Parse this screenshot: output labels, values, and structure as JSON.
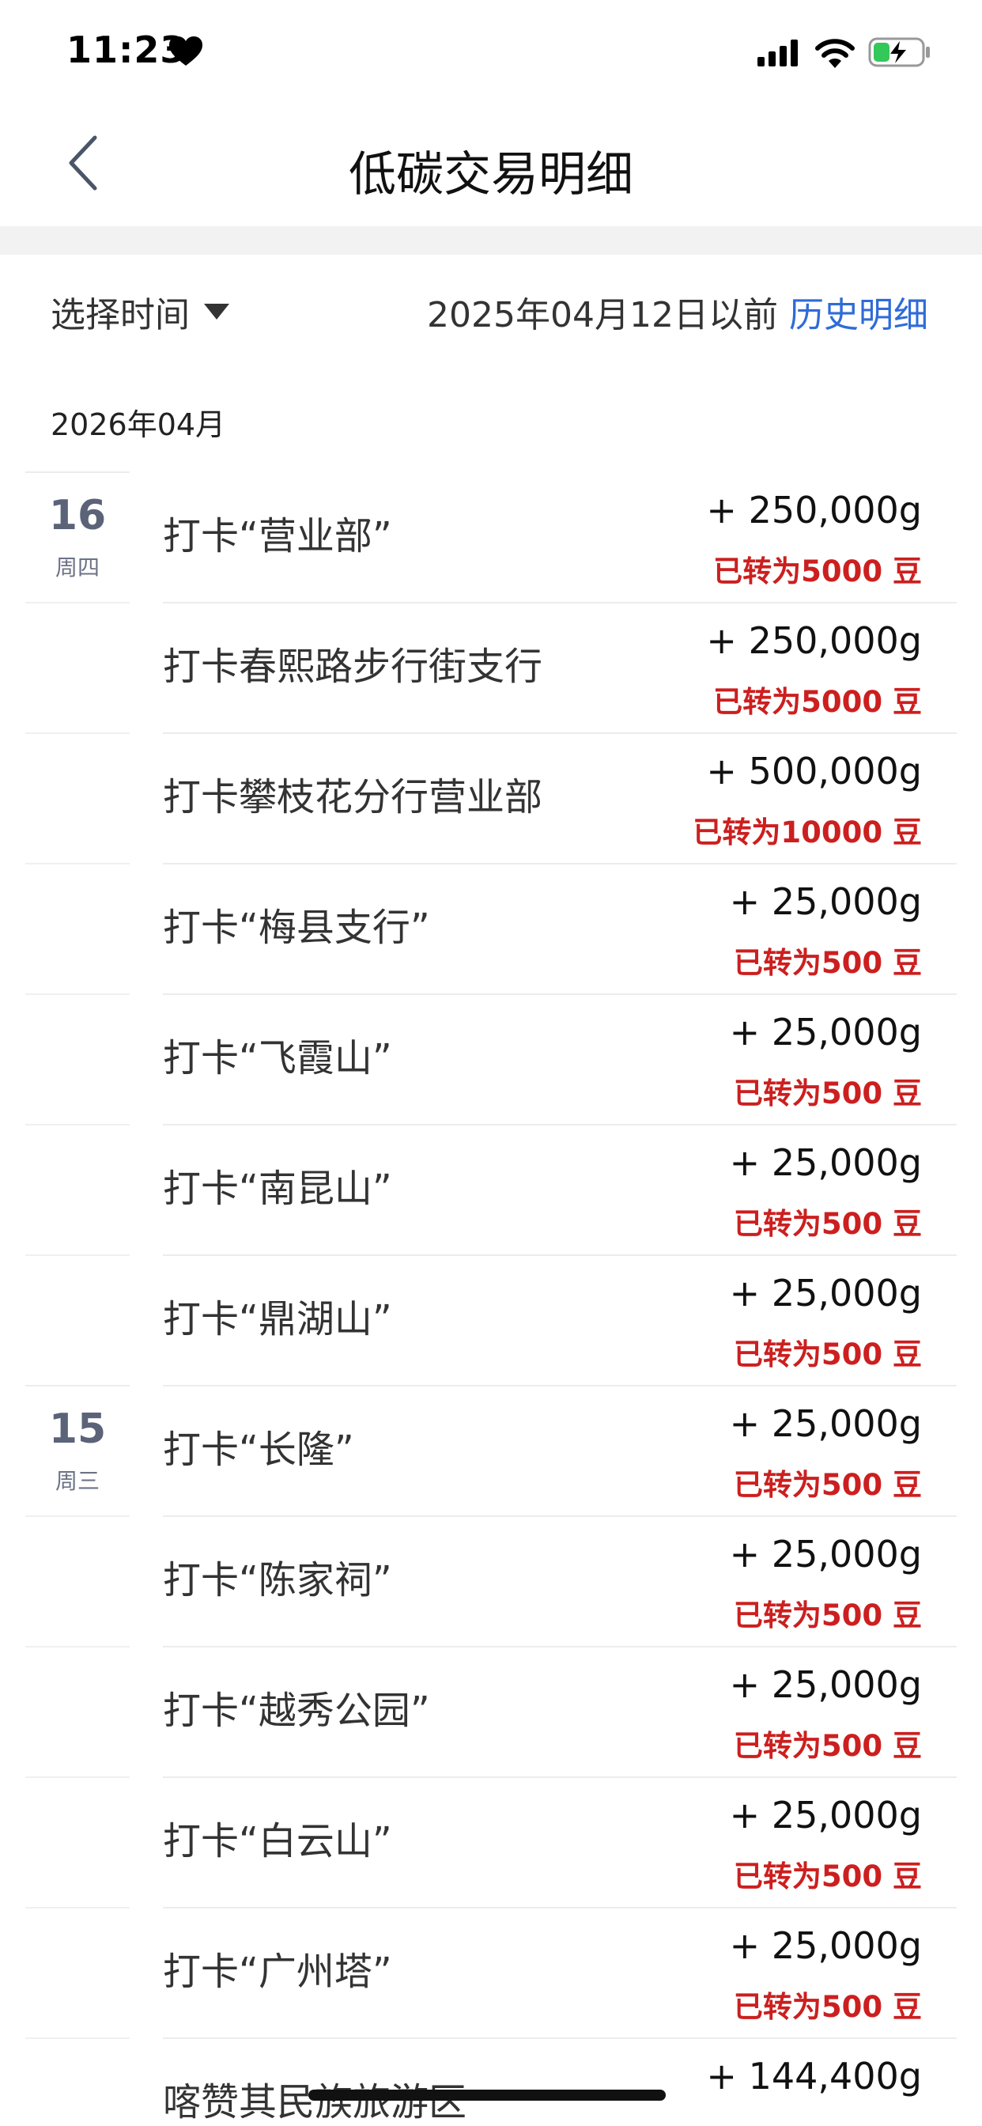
{
  "status_bar": {
    "time": "11:23"
  },
  "nav": {
    "title": "低碳交易明细"
  },
  "filter": {
    "select_label": "选择时间",
    "before_date": "2025年04月12日以前",
    "history_link": "历史明细"
  },
  "month": "2026年04月",
  "rows": [
    {
      "day": "16",
      "weekday": "周四",
      "title": "打卡“营业部”",
      "amount": "+ 250,000g",
      "converted": "已转为5000 豆"
    },
    {
      "day": "",
      "weekday": "",
      "title": "打卡春熙路步行街支行",
      "amount": "+ 250,000g",
      "converted": "已转为5000 豆"
    },
    {
      "day": "",
      "weekday": "",
      "title": "打卡攀枝花分行营业部",
      "amount": "+ 500,000g",
      "converted": "已转为10000 豆"
    },
    {
      "day": "",
      "weekday": "",
      "title": "打卡“梅县支行”",
      "amount": "+ 25,000g",
      "converted": "已转为500 豆"
    },
    {
      "day": "",
      "weekday": "",
      "title": "打卡“飞霞山”",
      "amount": "+ 25,000g",
      "converted": "已转为500 豆"
    },
    {
      "day": "",
      "weekday": "",
      "title": "打卡“南昆山”",
      "amount": "+ 25,000g",
      "converted": "已转为500 豆"
    },
    {
      "day": "",
      "weekday": "",
      "title": "打卡“鼎湖山”",
      "amount": "+ 25,000g",
      "converted": "已转为500 豆"
    },
    {
      "day": "15",
      "weekday": "周三",
      "title": "打卡“长隆”",
      "amount": "+ 25,000g",
      "converted": "已转为500 豆"
    },
    {
      "day": "",
      "weekday": "",
      "title": "打卡“陈家祠”",
      "amount": "+ 25,000g",
      "converted": "已转为500 豆"
    },
    {
      "day": "",
      "weekday": "",
      "title": "打卡“越秀公园”",
      "amount": "+ 25,000g",
      "converted": "已转为500 豆"
    },
    {
      "day": "",
      "weekday": "",
      "title": "打卡“白云山”",
      "amount": "+ 25,000g",
      "converted": "已转为500 豆"
    },
    {
      "day": "",
      "weekday": "",
      "title": "打卡“广州塔”",
      "amount": "+ 25,000g",
      "converted": "已转为500 豆"
    },
    {
      "day": "",
      "weekday": "",
      "title": "喀赞其民族旅游区",
      "amount": "+ 144,400g",
      "converted": ""
    }
  ]
}
